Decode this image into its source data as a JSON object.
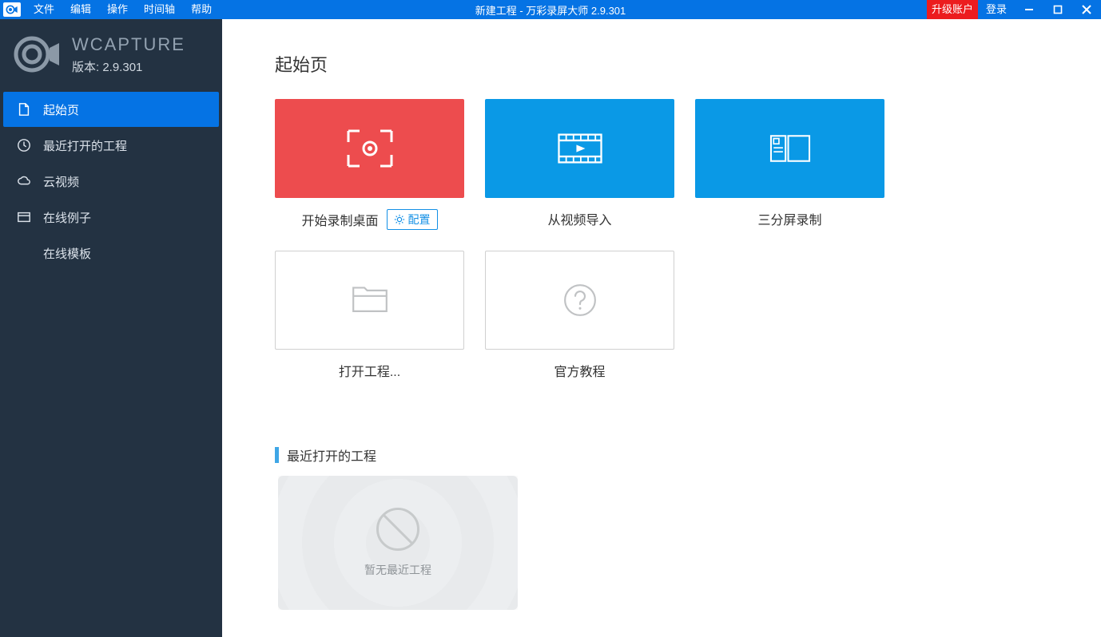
{
  "titlebar": {
    "menu": {
      "file": "文件",
      "edit": "编辑",
      "operate": "操作",
      "timeline": "时间轴",
      "help": "帮助"
    },
    "title": "新建工程 - 万彩录屏大师 2.9.301",
    "upgrade": "升级账户",
    "login": "登录"
  },
  "sidebar": {
    "brand": {
      "title": "WCAPTURE",
      "version": "版本: 2.9.301"
    },
    "items": {
      "start": "起始页",
      "recent": "最近打开的工程",
      "cloud": "云视频",
      "examples": "在线例子",
      "templates": "在线模板"
    }
  },
  "content": {
    "start_title": "起始页",
    "cards": {
      "record": {
        "label": "开始录制桌面",
        "config": "配置"
      },
      "import": {
        "label": "从视频导入"
      },
      "tri": {
        "label": "三分屏录制"
      },
      "open": {
        "label": "打开工程..."
      },
      "tutorial": {
        "label": "官方教程"
      }
    },
    "recent": {
      "title": "最近打开的工程",
      "empty": "暂无最近工程"
    }
  }
}
